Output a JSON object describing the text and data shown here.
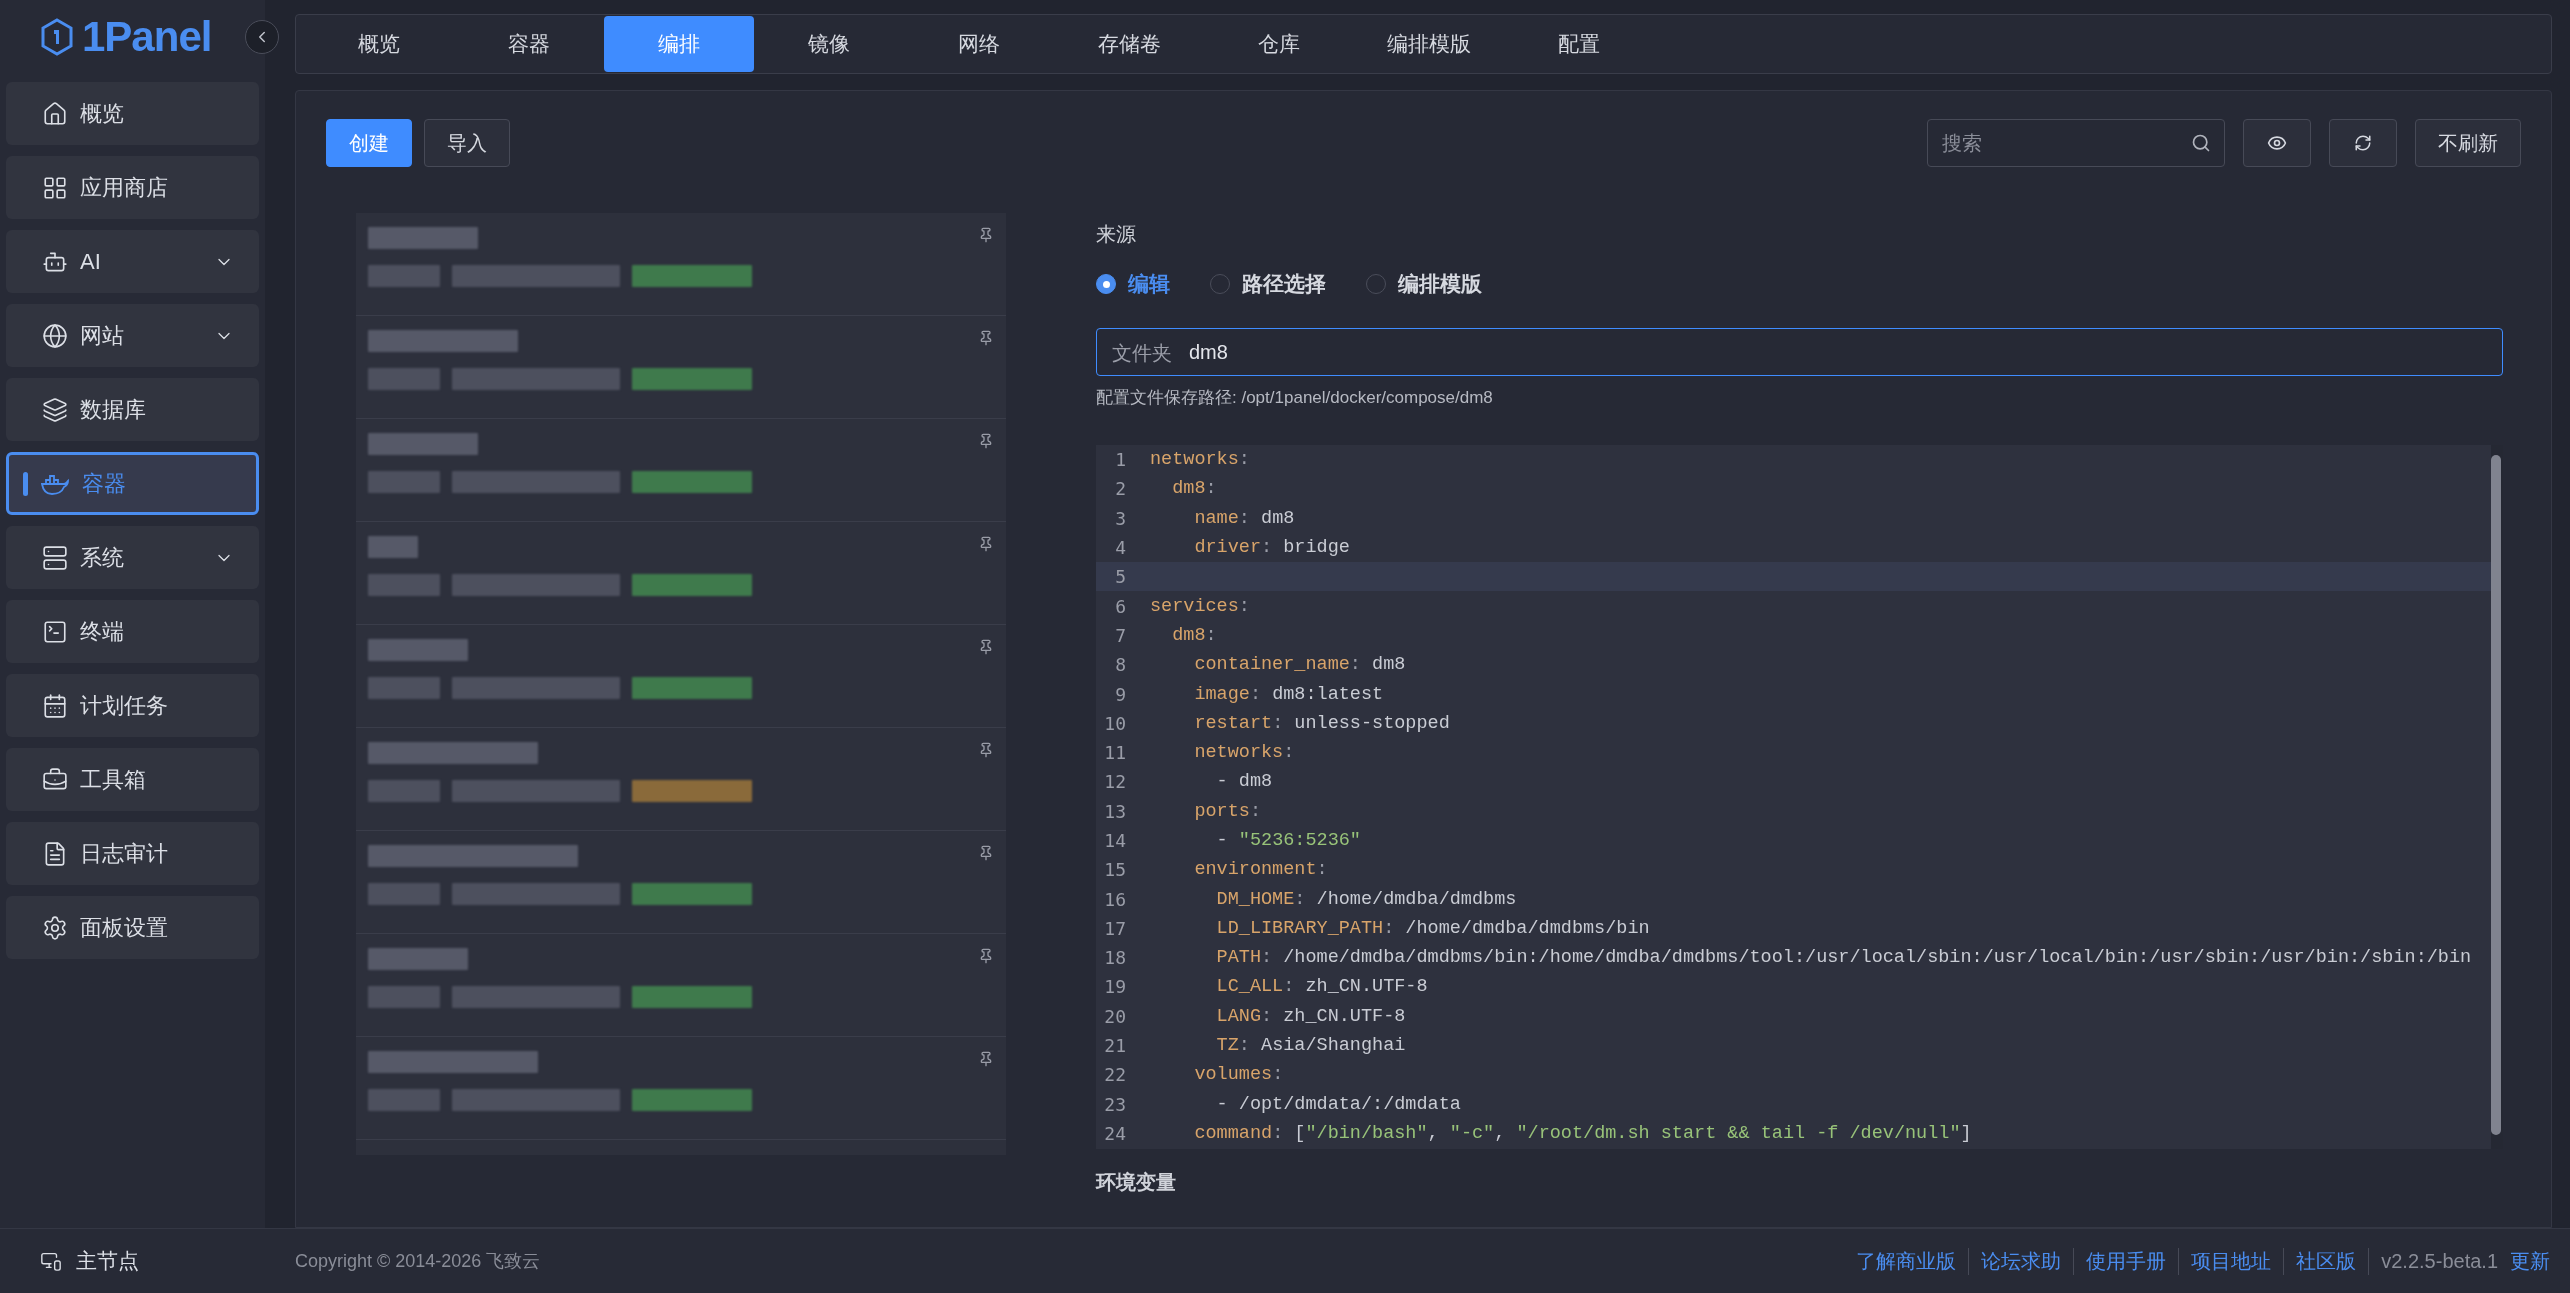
{
  "logo": {
    "text": "1Panel"
  },
  "sidebar": {
    "items": [
      {
        "label": "概览",
        "expandable": false,
        "selected": false
      },
      {
        "label": "应用商店",
        "expandable": false,
        "selected": false
      },
      {
        "label": "AI",
        "expandable": true,
        "selected": false
      },
      {
        "label": "网站",
        "expandable": true,
        "selected": false
      },
      {
        "label": "数据库",
        "expandable": false,
        "selected": false
      },
      {
        "label": "容器",
        "expandable": false,
        "selected": true
      },
      {
        "label": "系统",
        "expandable": true,
        "selected": false
      },
      {
        "label": "终端",
        "expandable": false,
        "selected": false
      },
      {
        "label": "计划任务",
        "expandable": false,
        "selected": false
      },
      {
        "label": "工具箱",
        "expandable": false,
        "selected": false
      },
      {
        "label": "日志审计",
        "expandable": false,
        "selected": false
      },
      {
        "label": "面板设置",
        "expandable": false,
        "selected": false
      }
    ],
    "node": "主节点"
  },
  "tabs": [
    {
      "label": "概览",
      "selected": false
    },
    {
      "label": "容器",
      "selected": false
    },
    {
      "label": "编排",
      "selected": true
    },
    {
      "label": "镜像",
      "selected": false
    },
    {
      "label": "网络",
      "selected": false
    },
    {
      "label": "存储卷",
      "selected": false
    },
    {
      "label": "仓库",
      "selected": false
    },
    {
      "label": "编排模版",
      "selected": false
    },
    {
      "label": "配置",
      "selected": false
    }
  ],
  "toolbar": {
    "create": "创建",
    "import": "导入",
    "search": {
      "placeholder": "搜索"
    },
    "no_refresh": "不刷新"
  },
  "compose_list": [
    {
      "color": "#3f7a4c"
    },
    {
      "color": "#3f7a4c"
    },
    {
      "color": "#3f7a4c"
    },
    {
      "color": "#3f7a4c"
    },
    {
      "color": "#3f7a4c"
    },
    {
      "color": "#8a6a3a"
    },
    {
      "color": "#3f7a4c"
    },
    {
      "color": "#3f7a4c"
    },
    {
      "color": "#3f7a4c"
    }
  ],
  "form": {
    "source_label": "来源",
    "source_options": [
      {
        "label": "编辑",
        "selected": true
      },
      {
        "label": "路径选择",
        "selected": false
      },
      {
        "label": "编排模版",
        "selected": false
      }
    ],
    "folder": {
      "prefix": "文件夹",
      "value": "dm8"
    },
    "path_hint": "配置文件保存路径: /opt/1panel/docker/compose/dm8",
    "code_lines": [
      {
        "number": "1",
        "current": false,
        "tokens": [
          {
            "kind": "key",
            "text": "networks"
          },
          {
            "kind": "punct",
            "text": ":"
          }
        ]
      },
      {
        "number": "2",
        "current": false,
        "tokens": [
          {
            "kind": "key",
            "text": "  dm8"
          },
          {
            "kind": "punct",
            "text": ":"
          }
        ]
      },
      {
        "number": "3",
        "current": false,
        "tokens": [
          {
            "kind": "key",
            "text": "    name"
          },
          {
            "kind": "punct",
            "text": ":"
          },
          {
            "kind": "plain",
            "text": " dm8"
          }
        ]
      },
      {
        "number": "4",
        "current": false,
        "tokens": [
          {
            "kind": "key",
            "text": "    driver"
          },
          {
            "kind": "punct",
            "text": ":"
          },
          {
            "kind": "plain",
            "text": " bridge"
          }
        ]
      },
      {
        "number": "5",
        "current": true
      },
      {
        "number": "6",
        "current": false,
        "tokens": [
          {
            "kind": "key",
            "text": "services"
          },
          {
            "kind": "punct",
            "text": ":"
          }
        ]
      },
      {
        "number": "7",
        "current": false,
        "tokens": [
          {
            "kind": "key",
            "text": "  dm8"
          },
          {
            "kind": "punct",
            "text": ":"
          }
        ]
      },
      {
        "number": "8",
        "current": false,
        "tokens": [
          {
            "kind": "key",
            "text": "    container_name"
          },
          {
            "kind": "punct",
            "text": ":"
          },
          {
            "kind": "plain",
            "text": " dm8"
          }
        ]
      },
      {
        "number": "9",
        "current": false,
        "tokens": [
          {
            "kind": "key",
            "text": "    image"
          },
          {
            "kind": "punct",
            "text": ":"
          },
          {
            "kind": "plain",
            "text": " dm8:latest"
          }
        ]
      },
      {
        "number": "10",
        "current": false,
        "tokens": [
          {
            "kind": "key",
            "text": "    restart"
          },
          {
            "kind": "punct",
            "text": ":"
          },
          {
            "kind": "plain",
            "text": " unless-stopped"
          }
        ]
      },
      {
        "number": "11",
        "current": false,
        "tokens": [
          {
            "kind": "key",
            "text": "    networks"
          },
          {
            "kind": "punct",
            "text": ":"
          }
        ]
      },
      {
        "number": "12",
        "current": false,
        "tokens": [
          {
            "kind": "plain",
            "text": "      - dm8"
          }
        ]
      },
      {
        "number": "13",
        "current": false,
        "tokens": [
          {
            "kind": "key",
            "text": "    ports"
          },
          {
            "kind": "punct",
            "text": ":"
          }
        ]
      },
      {
        "number": "14",
        "current": false,
        "tokens": [
          {
            "kind": "plain",
            "text": "      - "
          },
          {
            "kind": "string",
            "text": "\"5236:5236\""
          }
        ]
      },
      {
        "number": "15",
        "current": false,
        "tokens": [
          {
            "kind": "key",
            "text": "    environment"
          },
          {
            "kind": "punct",
            "text": ":"
          }
        ]
      },
      {
        "number": "16",
        "current": false,
        "tokens": [
          {
            "kind": "key",
            "text": "      DM_HOME"
          },
          {
            "kind": "punct",
            "text": ":"
          },
          {
            "kind": "plain",
            "text": " /home/dmdba/dmdbms"
          }
        ]
      },
      {
        "number": "17",
        "current": false,
        "tokens": [
          {
            "kind": "key",
            "text": "      LD_LIBRARY_PATH"
          },
          {
            "kind": "punct",
            "text": ":"
          },
          {
            "kind": "plain",
            "text": " /home/dmdba/dmdbms/bin"
          }
        ]
      },
      {
        "number": "18",
        "current": false,
        "tokens": [
          {
            "kind": "key",
            "text": "      PATH"
          },
          {
            "kind": "punct",
            "text": ":"
          },
          {
            "kind": "plain",
            "text": " /home/dmdba/dmdbms/bin:/home/dmdba/dmdbms/tool:/usr/local/sbin:/usr/local/bin:/usr/sbin:/usr/bin:/sbin:/bin"
          }
        ]
      },
      {
        "number": "19",
        "current": false,
        "tokens": [
          {
            "kind": "key",
            "text": "      LC_ALL"
          },
          {
            "kind": "punct",
            "text": ":"
          },
          {
            "kind": "plain",
            "text": " zh_CN.UTF-8"
          }
        ]
      },
      {
        "number": "20",
        "current": false,
        "tokens": [
          {
            "kind": "key",
            "text": "      LANG"
          },
          {
            "kind": "punct",
            "text": ":"
          },
          {
            "kind": "plain",
            "text": " zh_CN.UTF-8"
          }
        ]
      },
      {
        "number": "21",
        "current": false,
        "tokens": [
          {
            "kind": "key",
            "text": "      TZ"
          },
          {
            "kind": "punct",
            "text": ":"
          },
          {
            "kind": "plain",
            "text": " Asia/Shanghai"
          }
        ]
      },
      {
        "number": "22",
        "current": false,
        "tokens": [
          {
            "kind": "key",
            "text": "    volumes"
          },
          {
            "kind": "punct",
            "text": ":"
          }
        ]
      },
      {
        "number": "23",
        "current": false,
        "tokens": [
          {
            "kind": "plain",
            "text": "      - /opt/dmdata/:/dmdata"
          }
        ]
      },
      {
        "number": "24",
        "current": false,
        "tokens": [
          {
            "kind": "key",
            "text": "    command"
          },
          {
            "kind": "punct",
            "text": ":"
          },
          {
            "kind": "plain",
            "text": " ["
          },
          {
            "kind": "string",
            "text": "\"/bin/bash\""
          },
          {
            "kind": "plain",
            "text": ", "
          },
          {
            "kind": "string",
            "text": "\"-c\""
          },
          {
            "kind": "plain",
            "text": ", "
          },
          {
            "kind": "string",
            "text": "\"/root/dm.sh start && tail -f /dev/null\""
          },
          {
            "kind": "plain",
            "text": "]"
          }
        ]
      }
    ],
    "env_label": "环境变量"
  },
  "footer": {
    "copyright": "Copyright © 2014-2026 飞致云",
    "links": [
      "了解商业版",
      "论坛求助",
      "使用手册",
      "项目地址",
      "社区版"
    ],
    "version": "v2.2.5-beta.1",
    "update": "更新"
  }
}
